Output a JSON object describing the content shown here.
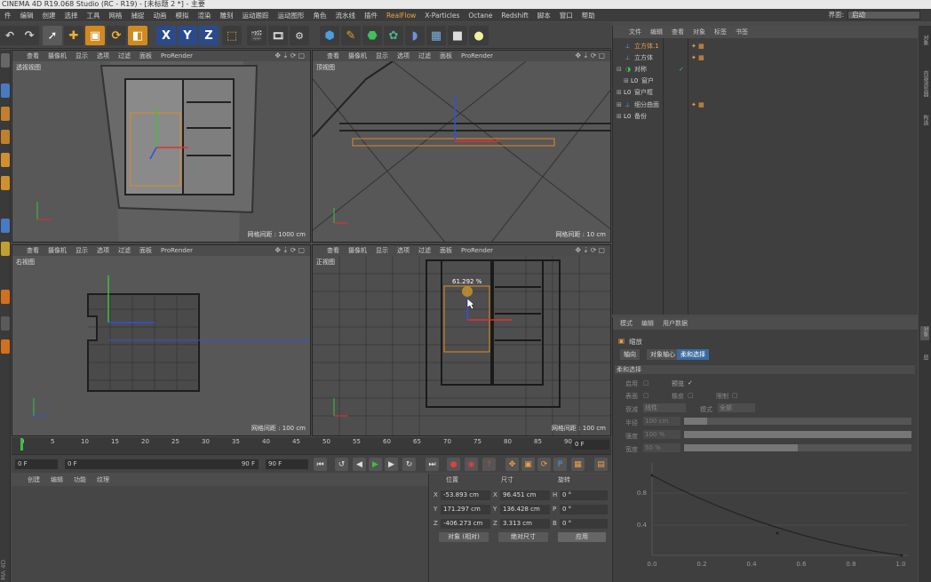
{
  "window": {
    "title": "CINEMA 4D R19.068 Studio (RC - R19) - [未标题 2 *] - 主要"
  },
  "menu": [
    "件",
    "编辑",
    "创建",
    "选择",
    "工具",
    "网格",
    "捕捉",
    "动画",
    "模拟",
    "渲染",
    "雕刻",
    "运动跟踪",
    "运动图形",
    "角色",
    "流水线",
    "插件",
    "RealFlow",
    "X-Particles",
    "Octane",
    "Redshift",
    "脚本",
    "窗口",
    "帮助"
  ],
  "menu_highlight": "RealFlow",
  "interface": {
    "label": "界面:",
    "value": "启动"
  },
  "toolbar": {
    "icons": [
      "undo-icon",
      "select-icon",
      "move-icon",
      "scale-icon",
      "rotate-icon",
      "live-select-icon",
      "x-axis-icon",
      "y-axis-icon",
      "z-axis-icon",
      "world-coord-icon",
      "render-view-icon",
      "render-picture-viewer-icon",
      "render-settings-icon",
      "cube-icon",
      "pen-icon",
      "nurbs-icon",
      "deformer-icon",
      "environment-icon",
      "floor-icon",
      "camera-icon",
      "light-icon"
    ],
    "axis_x": "X",
    "axis_y": "Y",
    "axis_z": "Z"
  },
  "viewport_menu": [
    "查看",
    "摄像机",
    "显示",
    "选项",
    "过滤",
    "面板",
    "ProRender"
  ],
  "viewports": {
    "perspective": {
      "label": "透视视图",
      "grid": "网格间距 : 1000 cm"
    },
    "top": {
      "label": "顶视图",
      "grid": "网格间距 : 10 cm"
    },
    "right": {
      "label": "右视图",
      "grid": "网格间距 : 100 cm"
    },
    "front": {
      "label": "正视图",
      "grid": "网格间距 : 100 cm",
      "readout": "61.292 %"
    }
  },
  "timeline": {
    "ticks": [
      "0",
      "5",
      "10",
      "15",
      "20",
      "25",
      "30",
      "35",
      "40",
      "45",
      "50",
      "55",
      "60",
      "65",
      "70",
      "75",
      "80",
      "85",
      "90"
    ],
    "frame": "0 F"
  },
  "transport": {
    "start": "0 F",
    "current": "0 F",
    "end_range": "90 F",
    "end": "90 F"
  },
  "material_manager": {
    "menu": [
      "创建",
      "编辑",
      "功能",
      "纹理"
    ]
  },
  "coords": {
    "headers": [
      "位置",
      "尺寸",
      "旋转"
    ],
    "rows": [
      {
        "axis": "X",
        "pos": "-53.893 cm",
        "size_axis": "X",
        "size": "96.451 cm",
        "rot_axis": "H",
        "rot": "0 °"
      },
      {
        "axis": "Y",
        "pos": "171.297 cm",
        "size_axis": "Y",
        "size": "136.428 cm",
        "rot_axis": "P",
        "rot": "0 °"
      },
      {
        "axis": "Z",
        "pos": "-406.273 cm",
        "size_axis": "Z",
        "size": "3.313 cm",
        "rot_axis": "B",
        "rot": "0 °"
      }
    ],
    "mode1": "对象 (相对)",
    "mode2": "绝对尺寸",
    "apply": "应用"
  },
  "object_manager": {
    "menu": [
      "文件",
      "编辑",
      "查看",
      "对象",
      "标签",
      "书签"
    ],
    "objects": [
      {
        "name": "立方体.1",
        "selected": true
      },
      {
        "name": "立方体",
        "selected": false
      },
      {
        "name": "对称",
        "selected": false
      },
      {
        "name": "窗户",
        "selected": false
      },
      {
        "name": "窗户框",
        "selected": false
      },
      {
        "name": "细分曲面",
        "selected": false
      },
      {
        "name": "备份",
        "selected": false
      }
    ]
  },
  "attributes": {
    "menu": [
      "模式",
      "编辑",
      "用户数据"
    ],
    "title": "缩放",
    "tabs": [
      "轴向",
      "对象轴心",
      "柔和选择"
    ],
    "section": "柔和选择",
    "fields": {
      "enable": "启用",
      "preview": "预览",
      "surface": "表面",
      "rubber": "橡皮",
      "restrict": "限制",
      "falloff": "衰减",
      "falloff_value": "线性",
      "mode": "模式",
      "mode_value": "全部",
      "radius": "半径",
      "radius_value": "100 cm",
      "strength": "强度",
      "strength_value": "100 %",
      "width": "宽度",
      "width_value": "50 %"
    },
    "curve": {
      "y_ticks": [
        "0.8",
        "0.4"
      ],
      "x_ticks": [
        "0.0",
        "0.2",
        "0.4",
        "0.6",
        "0.8",
        "1.0"
      ]
    }
  },
  "right_sidebar": [
    "对象",
    "内容浏览器",
    "构造",
    "层"
  ],
  "bottom_left": "MA 4D"
}
